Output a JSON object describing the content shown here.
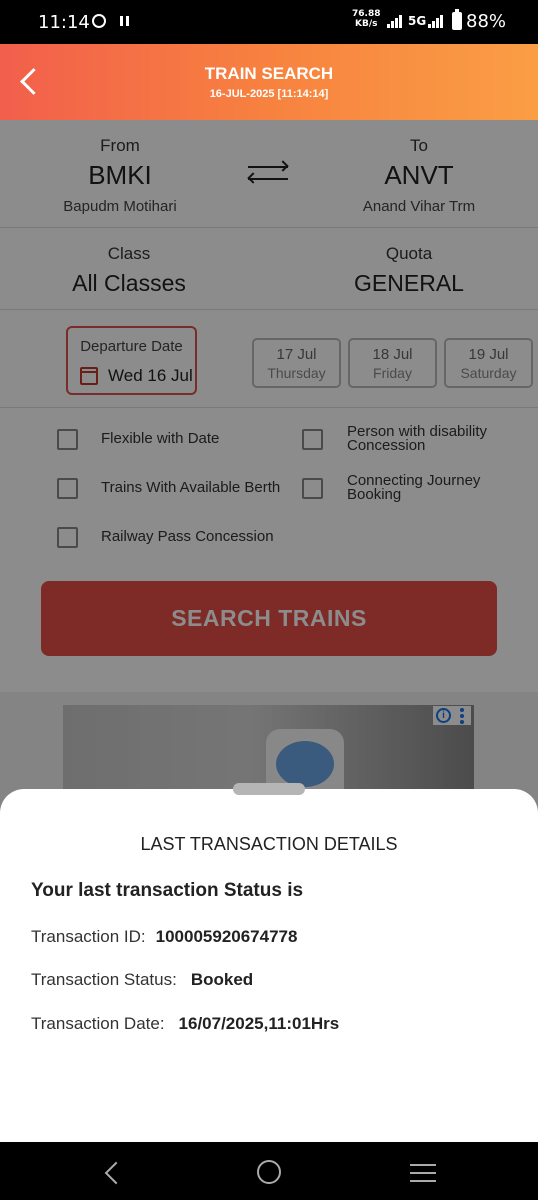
{
  "status_bar": {
    "time": "11:14",
    "net_speed_value": "76.88",
    "net_speed_unit": "KB/s",
    "network": "5G",
    "battery": "88%"
  },
  "header": {
    "title": "TRAIN SEARCH",
    "subtitle": "16-JUL-2025 [11:14:14]"
  },
  "route": {
    "from_label": "From",
    "from_code": "BMKI",
    "from_name": "Bapudm Motihari",
    "to_label": "To",
    "to_code": "ANVT",
    "to_name": "Anand Vihar Trm"
  },
  "options": {
    "class_label": "Class",
    "class_value": "All Classes",
    "quota_label": "Quota",
    "quota_value": "GENERAL"
  },
  "date": {
    "departure_label": "Departure Date",
    "departure_value": "Wed 16 Jul",
    "chips": [
      {
        "date": "17 Jul",
        "day": "Thursday"
      },
      {
        "date": "18 Jul",
        "day": "Friday"
      },
      {
        "date": "19 Jul",
        "day": "Saturday"
      }
    ]
  },
  "filters": {
    "flexible": "Flexible with Date",
    "available_berth": "Trains With Available Berth",
    "railway_pass": "Railway Pass Concession",
    "disability_line1": "Person with disability",
    "disability_line2": "Concession",
    "connecting_line1": "Connecting Journey",
    "connecting_line2": "Booking"
  },
  "search_button": "SEARCH TRAINS",
  "ad": {
    "info_glyph": "i"
  },
  "sheet": {
    "title": "LAST TRANSACTION DETAILS",
    "heading": "Your last transaction Status is",
    "id_label": "Transaction ID:",
    "id_value": "100005920674778",
    "status_label": "Transaction Status:",
    "status_value": "Booked",
    "date_label": "Transaction Date:",
    "date_value": "16/07/2025,11:01Hrs"
  }
}
